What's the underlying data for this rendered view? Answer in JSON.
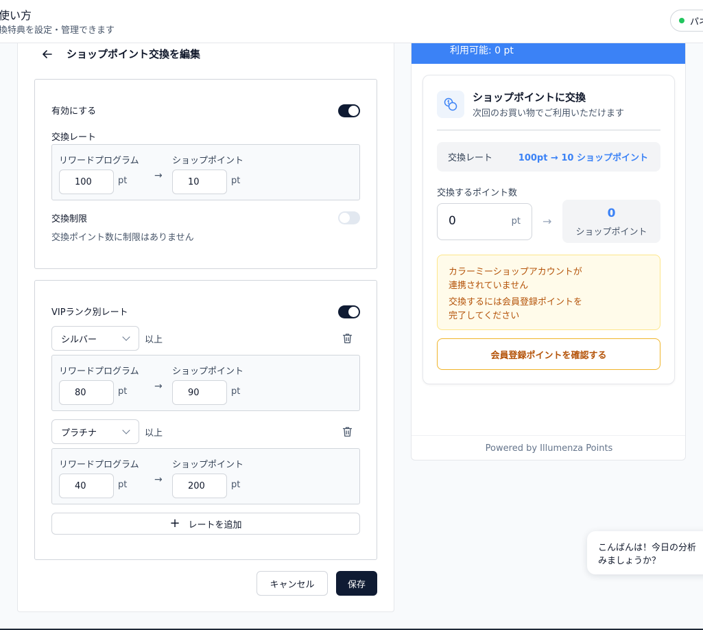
{
  "header": {
    "title": "使い方",
    "subtitle": "換特典を設定・管理できます",
    "status_label": "パネ",
    "status_color": "#22c55e"
  },
  "editor": {
    "title": "ショップポイント交換を編集",
    "enable_label": "有効にする",
    "enable_on": true,
    "rate_label": "交換レート",
    "rate": {
      "from_label": "リワードプログラム",
      "from_value": "100",
      "to_label": "ショップポイント",
      "to_value": "10",
      "unit": "pt"
    },
    "limit_label": "交換制限",
    "limit_on": false,
    "limit_desc": "交換ポイント数に制限はありません",
    "vip_label": "VIPランク別レート",
    "vip_on": true,
    "vip_rates": [
      {
        "rank": "シルバー",
        "suffix": "以上",
        "from_label": "リワードプログラム",
        "from_value": "80",
        "to_label": "ショップポイント",
        "to_value": "90",
        "unit": "pt"
      },
      {
        "rank": "プラチナ",
        "suffix": "以上",
        "from_label": "リワードプログラム",
        "from_value": "40",
        "to_label": "ショップポイント",
        "to_value": "200",
        "unit": "pt"
      }
    ],
    "add_rate_label": "レートを追加",
    "cancel_label": "キャンセル",
    "save_label": "保存"
  },
  "preview": {
    "available": "利用可能: 0 pt",
    "card_title": "ショップポイントに交換",
    "card_subtitle": "次回のお買い物でご利用いただけます",
    "rate_key": "交換レート",
    "rate_value": "100pt → 10 ショップポイント",
    "quantity_label": "交換するポイント数",
    "quantity_value": "0",
    "quantity_unit": "pt",
    "result_value": "0",
    "result_label": "ショップポイント",
    "warning_line1": "カラーミーショップアカウントが",
    "warning_line2": "連携されていません",
    "warning_line3": "交換するには会員登録ポイントを",
    "warning_line4": "完了してください",
    "confirm_label": "会員登録ポイントを確認する",
    "footer": "Powered by Illumenza Points",
    "accent_color": "#3b82f6"
  },
  "chat": {
    "line1": "こんばんは！今日の分析",
    "line2": "みましょうか？"
  }
}
